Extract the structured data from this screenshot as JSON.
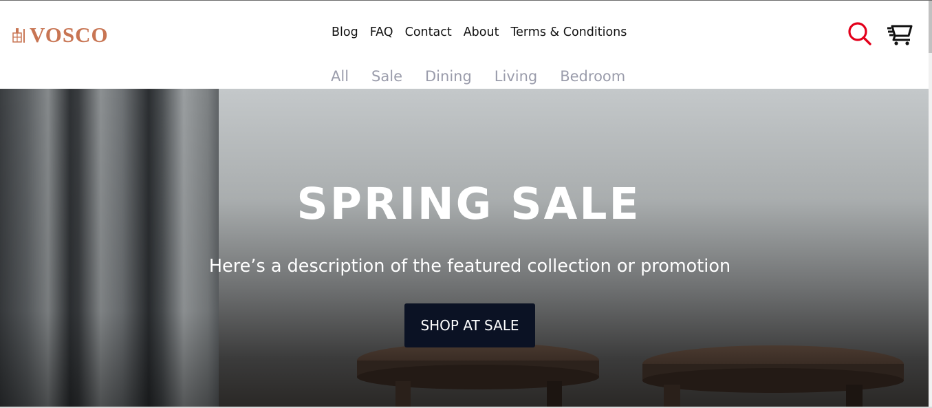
{
  "brand": {
    "name": "VOSCO",
    "color": "#c87553"
  },
  "nav": {
    "main": [
      {
        "label": "Blog"
      },
      {
        "label": "FAQ"
      },
      {
        "label": "Contact"
      },
      {
        "label": "About"
      },
      {
        "label": "Terms & Conditions"
      }
    ],
    "categories": [
      {
        "label": "All"
      },
      {
        "label": "Sale"
      },
      {
        "label": "Dining"
      },
      {
        "label": "Living"
      },
      {
        "label": "Bedroom"
      }
    ]
  },
  "icons": {
    "search": "search-icon",
    "cart": "cart-icon",
    "search_color": "#e3001b"
  },
  "hero": {
    "title": "SPRING SALE",
    "subtitle": "Here’s a description of the featured collection or promotion",
    "cta_label": "SHOP AT SALE",
    "cta_color": "#0b1224"
  }
}
